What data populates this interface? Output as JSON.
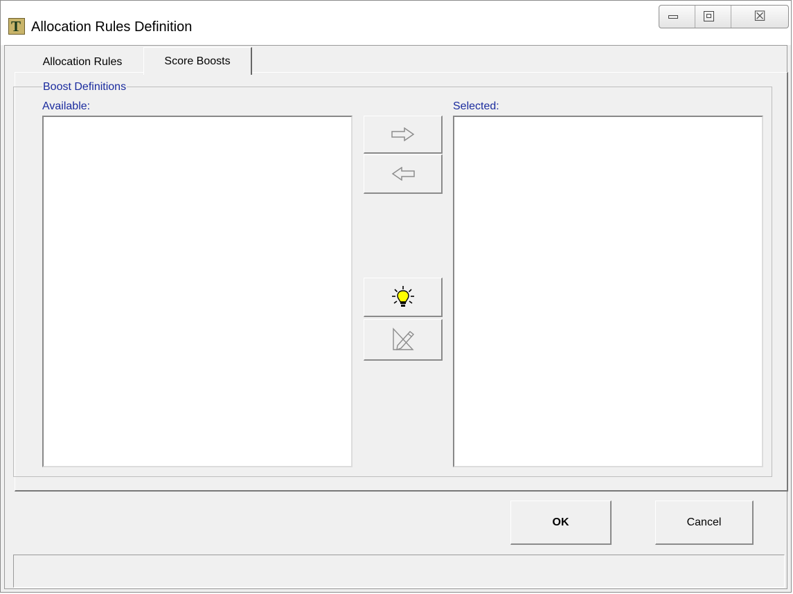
{
  "window": {
    "title": "Allocation Rules Definition",
    "app_icon_letter": "T"
  },
  "titlebar": {
    "close_glyph": "☒"
  },
  "tabs": [
    {
      "label": "Allocation Rules",
      "active": false
    },
    {
      "label": "Score Boosts",
      "active": true
    }
  ],
  "group": {
    "legend": "Boost Definitions",
    "available_label": "Available:",
    "selected_label": "Selected:",
    "available_items": [],
    "selected_items": []
  },
  "buttons": {
    "move_right_icon": "arrow-right-icon",
    "move_left_icon": "arrow-left-icon",
    "new_icon": "lightbulb-icon",
    "edit_icon": "pencil-icon",
    "ok": "OK",
    "cancel": "Cancel"
  },
  "colors": {
    "label_blue": "#1a2b9e",
    "bulb_yellow": "#ffff00"
  }
}
